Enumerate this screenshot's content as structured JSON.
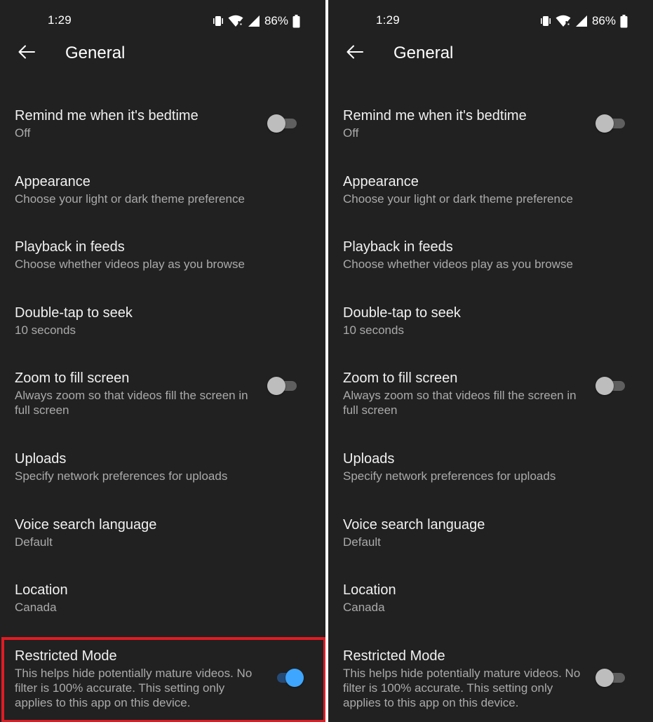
{
  "panels": [
    {
      "status": {
        "time": "1:29",
        "battery": "86%"
      },
      "app_bar": {
        "title": "General"
      },
      "settings": [
        {
          "title": "Remind me when it's bedtime",
          "subtitle": "Off",
          "toggle": "off"
        },
        {
          "title": "Appearance",
          "subtitle": "Choose your light or dark theme preference"
        },
        {
          "title": "Playback in feeds",
          "subtitle": "Choose whether videos play as you browse"
        },
        {
          "title": "Double-tap to seek",
          "subtitle": "10 seconds"
        },
        {
          "title": "Zoom to fill screen",
          "subtitle": "Always zoom so that videos fill the screen in full screen",
          "toggle": "off"
        },
        {
          "title": "Uploads",
          "subtitle": "Specify network preferences for uploads"
        },
        {
          "title": "Voice search language",
          "subtitle": "Default"
        },
        {
          "title": "Location",
          "subtitle": "Canada"
        },
        {
          "title": "Restricted Mode",
          "subtitle": "This helps hide potentially mature videos. No filter is 100% accurate. This setting only applies to this app on this device.",
          "toggle": "on"
        }
      ]
    },
    {
      "status": {
        "time": "1:29",
        "battery": "86%"
      },
      "app_bar": {
        "title": "General"
      },
      "settings": [
        {
          "title": "Remind me when it's bedtime",
          "subtitle": "Off",
          "toggle": "off"
        },
        {
          "title": "Appearance",
          "subtitle": "Choose your light or dark theme preference"
        },
        {
          "title": "Playback in feeds",
          "subtitle": "Choose whether videos play as you browse"
        },
        {
          "title": "Double-tap to seek",
          "subtitle": "10 seconds"
        },
        {
          "title": "Zoom to fill screen",
          "subtitle": "Always zoom so that videos fill the screen in full screen",
          "toggle": "off"
        },
        {
          "title": "Uploads",
          "subtitle": "Specify network preferences for uploads"
        },
        {
          "title": "Voice search language",
          "subtitle": "Default"
        },
        {
          "title": "Location",
          "subtitle": "Canada"
        },
        {
          "title": "Restricted Mode",
          "subtitle": "This helps hide potentially mature videos. No filter is 100% accurate. This setting only applies to this app on this device.",
          "toggle": "off"
        }
      ]
    }
  ],
  "icons": {
    "back": "arrow-left-icon",
    "vibrate": "vibrate-icon",
    "wifi": "wifi-icon",
    "signal": "cell-signal-icon",
    "battery": "battery-icon"
  },
  "colors": {
    "background": "#212121",
    "text_primary": "#f1f1f1",
    "text_secondary": "#aaaaaa",
    "toggle_on_thumb": "#3ea6ff",
    "toggle_on_track": "#244b78",
    "toggle_off_thumb": "#bdbdbd",
    "toggle_off_track": "#5f5f5f",
    "highlight": "#e01b24"
  }
}
